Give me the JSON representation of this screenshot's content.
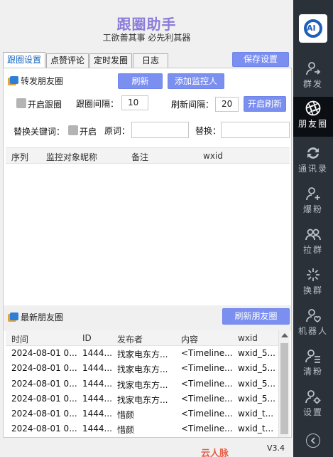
{
  "header": {
    "title": "跟圈助手",
    "slogan": "工欲善其事 必先利其器"
  },
  "tabs": [
    "跟圈设置",
    "点赞评论",
    "定时发圈",
    "日志"
  ],
  "save_button": "保存设置",
  "forward_section": {
    "title": "转发朋友圈",
    "refresh_button": "刷新",
    "add_monitor_button": "添加监控人",
    "enable_follow_label": "开启跟圈",
    "follow_interval_label": "跟圈间隔：",
    "follow_interval_value": "10",
    "refresh_interval_label": "刷新间隔：",
    "refresh_interval_value": "20",
    "start_refresh_button": "开启刷新",
    "replace_keyword_label": "替换关键词：",
    "enable_label": "开启",
    "original_word_label": "原词：",
    "original_word_value": "",
    "replace_label": "替换：",
    "replace_value": "",
    "columns": [
      "序列",
      "监控对象昵称",
      "备注",
      "wxid"
    ]
  },
  "latest_section": {
    "title": "最新朋友圈",
    "refresh_button": "刷新朋友圈",
    "columns": [
      "时间",
      "ID",
      "发布者",
      "内容",
      "wxid"
    ],
    "rows": [
      [
        "2024-08-01 0...",
        "1444...",
        "找家电东方...",
        "<Timeline...",
        "wxid_5..."
      ],
      [
        "2024-08-01 0...",
        "1444...",
        "找家电东方...",
        "<Timeline...",
        "wxid_5..."
      ],
      [
        "2024-08-01 0...",
        "1444...",
        "找家电东方...",
        "<Timeline...",
        "wxid_5..."
      ],
      [
        "2024-08-01 0...",
        "1444...",
        "找家电东方...",
        "<Timeline...",
        "wxid_5..."
      ],
      [
        "2024-08-01 0...",
        "1444...",
        "惜颜",
        "<Timeline...",
        "wxid_t..."
      ],
      [
        "2024-08-01 0...",
        "1444...",
        "惜颜",
        "<Timeline...",
        "wxid_t..."
      ]
    ]
  },
  "version": "V3.4",
  "watermark": "云人脉www.yunyunpe.com",
  "sidebar": {
    "logo_text": "AI",
    "items": [
      {
        "label": "群发",
        "icon": "user-send-icon"
      },
      {
        "label": "朋友圈",
        "icon": "aperture-icon",
        "active": true
      },
      {
        "label": "通讯录",
        "icon": "sync-icon"
      },
      {
        "label": "爆粉",
        "icon": "user-add-icon"
      },
      {
        "label": "拉群",
        "icon": "group-icon"
      },
      {
        "label": "换群",
        "icon": "sparkle-icon"
      },
      {
        "label": "机器人",
        "icon": "user-heart-icon"
      },
      {
        "label": "清粉",
        "icon": "user-list-icon"
      },
      {
        "label": "设置",
        "icon": "user-gear-icon"
      }
    ]
  },
  "colors": {
    "accent": "#7b8ff0",
    "title": "#8a7bd9",
    "sidebar": "#2b3138"
  }
}
